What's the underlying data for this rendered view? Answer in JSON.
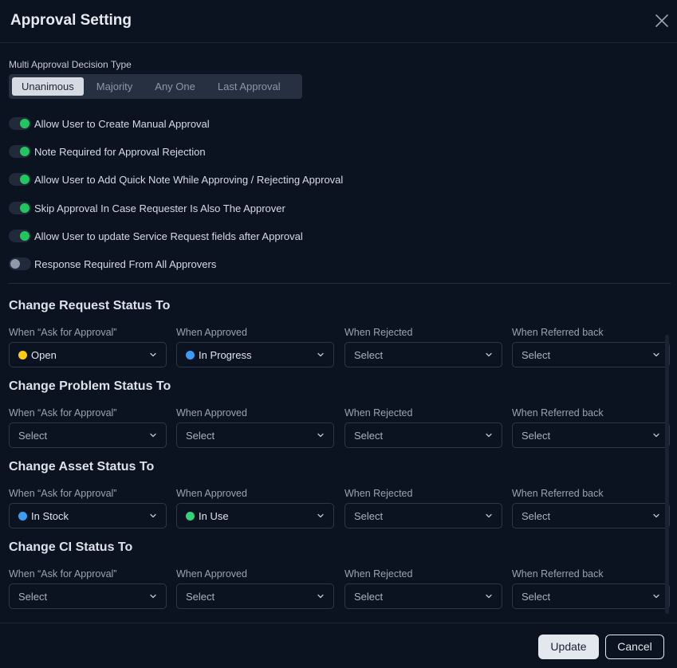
{
  "dialog": {
    "title": "Approval Setting"
  },
  "decision_type": {
    "label": "Multi Approval Decision Type",
    "options": [
      "Unanimous",
      "Majority",
      "Any One",
      "Last Approval"
    ],
    "selected": "Unanimous"
  },
  "toggles": [
    {
      "label": "Allow User to Create Manual Approval",
      "on": true
    },
    {
      "label": "Note Required for Approval Rejection",
      "on": true
    },
    {
      "label": "Allow User to Add Quick Note While Approving / Rejecting Approval",
      "on": true
    },
    {
      "label": "Skip Approval In Case Requester Is Also The Approver",
      "on": true
    },
    {
      "label": "Allow User to update Service Request fields after Approval",
      "on": true
    },
    {
      "label": "Response Required From All Approvers",
      "on": false
    }
  ],
  "columns": [
    "When “Ask for Approval”",
    "When Approved",
    "When Rejected",
    "When Referred back"
  ],
  "placeholder": "Select",
  "groups": [
    {
      "title": "Change Request Status To",
      "values": [
        {
          "text": "Open",
          "color": "#facc15"
        },
        {
          "text": "In Progress",
          "color": "#3b9cf5"
        },
        {
          "text": "Select",
          "color": null
        },
        {
          "text": "Select",
          "color": null
        }
      ]
    },
    {
      "title": "Change Problem Status To",
      "values": [
        {
          "text": "Select",
          "color": null
        },
        {
          "text": "Select",
          "color": null
        },
        {
          "text": "Select",
          "color": null
        },
        {
          "text": "Select",
          "color": null
        }
      ]
    },
    {
      "title": "Change Asset Status To",
      "values": [
        {
          "text": "In Stock",
          "color": "#3b9cf5"
        },
        {
          "text": "In Use",
          "color": "#34d17a"
        },
        {
          "text": "Select",
          "color": null
        },
        {
          "text": "Select",
          "color": null
        }
      ]
    },
    {
      "title": "Change CI Status To",
      "values": [
        {
          "text": "Select",
          "color": null
        },
        {
          "text": "Select",
          "color": null
        },
        {
          "text": "Select",
          "color": null
        },
        {
          "text": "Select",
          "color": null
        }
      ]
    }
  ],
  "footer": {
    "update_label": "Update",
    "cancel_label": "Cancel"
  },
  "colors": {
    "toggle_on": "#22c55e",
    "toggle_off": "#8f99ab",
    "background": "#0b1220"
  },
  "icons": {
    "close": "close-icon",
    "select_caret": "chevron-down-icon"
  }
}
